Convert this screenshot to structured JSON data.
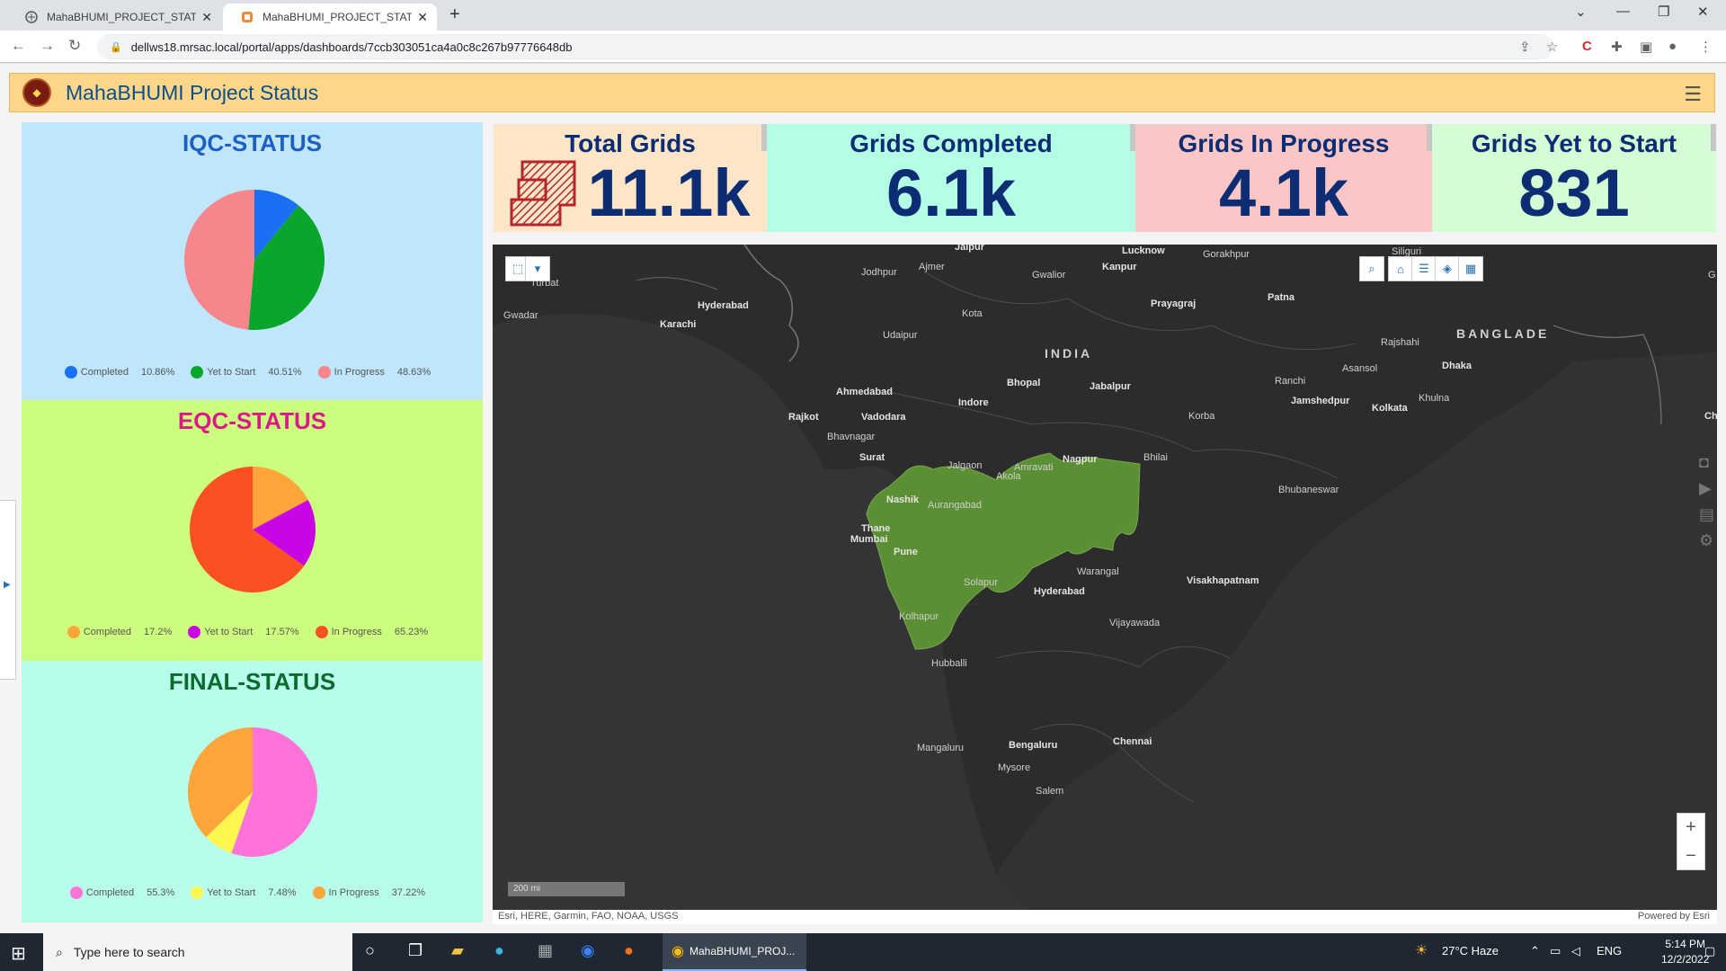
{
  "browser": {
    "tabs": [
      {
        "label": "MahaBHUMI_PROJECT_STATUS -"
      },
      {
        "label": "MahaBHUMI_PROJECT_STATUS"
      }
    ],
    "url": "dellws18.mrsac.local/portal/apps/dashboards/7ccb303051ca4a0c8c267b97776648db"
  },
  "header": {
    "title": "MahaBHUMI Project Status"
  },
  "kpis": [
    {
      "title": "Total Grids",
      "value": "11.1k",
      "bg": "#fde6c8"
    },
    {
      "title": "Grids Completed",
      "value": "6.1k",
      "bg": "#b5fee6"
    },
    {
      "title": "Grids In Progress",
      "value": "4.1k",
      "bg": "#fbc6c6"
    },
    {
      "title": "Grids Yet to Start",
      "value": "831",
      "bg": "#d5fdd5"
    }
  ],
  "charts": {
    "iqc": {
      "title": "IQC-STATUS",
      "title_color": "#1d60c2",
      "bg": "#bfe6fb"
    },
    "eqc": {
      "title": "EQC-STATUS",
      "title_color": "#d91a86",
      "bg": "#cdfd7e"
    },
    "final": {
      "title": "FINAL-STATUS",
      "title_color": "#0b6b2e",
      "bg": "#b8fdec"
    }
  },
  "chart_data": [
    {
      "type": "pie",
      "title": "IQC-STATUS",
      "categories": [
        "Completed",
        "Yet to Start",
        "In Progress"
      ],
      "values": [
        10.86,
        40.51,
        48.63
      ],
      "labels": [
        "10.86%",
        "40.51%",
        "48.63%"
      ],
      "colors": [
        "#1a6ff2",
        "#0aa62c",
        "#f7858c"
      ]
    },
    {
      "type": "pie",
      "title": "EQC-STATUS",
      "categories": [
        "Completed",
        "Yet to Start",
        "In Progress"
      ],
      "values": [
        17.2,
        17.57,
        65.23
      ],
      "labels": [
        "17.2%",
        "17.57%",
        "65.23%"
      ],
      "colors": [
        "#fea53a",
        "#c805e3",
        "#fb5021"
      ]
    },
    {
      "type": "pie",
      "title": "FINAL-STATUS",
      "categories": [
        "Completed",
        "Yet to Start",
        "In Progress"
      ],
      "values": [
        55.3,
        7.48,
        37.22
      ],
      "labels": [
        "55.3%",
        "7.48%",
        "37.22%"
      ],
      "colors": [
        "#fd73d7",
        "#fdf550",
        "#fea53a"
      ]
    }
  ],
  "map": {
    "country_label": "INDIA",
    "neighbor_label": "BANGLADE",
    "cities": [
      "Jaipur",
      "Lucknow",
      "Kanpur",
      "Gorakhpur",
      "Ajmer",
      "Jodhpur",
      "Gwalior",
      "Turbat",
      "Hyderabad",
      "Karachi",
      "Gwadar",
      "Prayagraj",
      "Patna",
      "Kota",
      "Udaipur",
      "Rajshahi",
      "Asansol",
      "Dhaka",
      "Ranchi",
      "Bhopal",
      "Jabalpur",
      "Ahmedabad",
      "Indore",
      "Jamshedpur",
      "Kolkata",
      "Khulna",
      "Rajkot",
      "Vadodara",
      "Korba",
      "Bhavnagar",
      "Surat",
      "Nagpur",
      "Bhilai",
      "Jalgaon",
      "Amravati",
      "Akola",
      "Bhubaneswar",
      "Nashik",
      "Aurangabad",
      "Thane",
      "Mumbai",
      "Pune",
      "Warangal",
      "Solapur",
      "Visakhapatnam",
      "Hyderabad",
      "Kolhapur",
      "Vijayawada",
      "Hubballi",
      "Mangaluru",
      "Bengaluru",
      "Chennai",
      "Mysore",
      "Salem",
      "Siliguri",
      "Ch",
      "G"
    ],
    "scale": "200 mi",
    "attribution": "Esri, HERE, Garmin, FAO, NOAA, USGS",
    "powered": "Powered by Esri",
    "state_color": "#5b8f33"
  },
  "taskbar": {
    "search_placeholder": "Type here to search",
    "chrome_label": "MahaBHUMI_PROJ...",
    "weather": "27°C  Haze",
    "lang": "ENG",
    "time": "5:14 PM",
    "date": "12/2/2022"
  }
}
